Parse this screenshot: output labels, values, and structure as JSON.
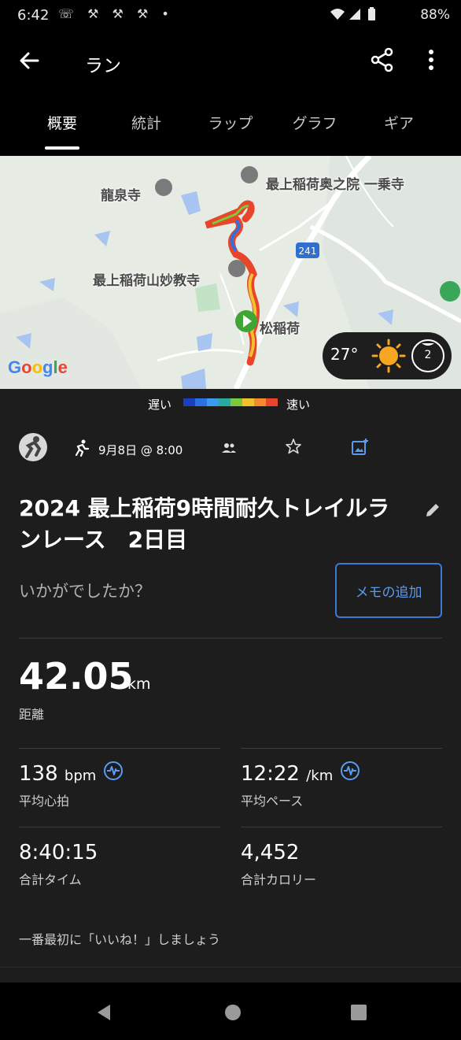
{
  "status_bar": {
    "time": "6:42",
    "notification_icons": "☏ ⚒ ⚒ ⚒ •",
    "battery": "88%"
  },
  "app_bar": {
    "title": "ラン"
  },
  "tabs": [
    {
      "label": "概要",
      "active": true
    },
    {
      "label": "統計",
      "active": false
    },
    {
      "label": "ラップ",
      "active": false
    },
    {
      "label": "グラフ",
      "active": false
    },
    {
      "label": "ギア",
      "active": false
    }
  ],
  "map": {
    "labels": {
      "ryusenji": "龍泉寺",
      "okunoin": "最上稲荷奥之院 一乗寺",
      "myokyoji": "最上稲荷山妙教寺",
      "matsuinari": "松稲荷",
      "route": "241"
    },
    "google": "Google",
    "weather": {
      "temperature": "27°",
      "moon_phase": "2"
    }
  },
  "legend": {
    "slow": "遅い",
    "fast": "速い",
    "colors": [
      "#1a3fbf",
      "#2b72e0",
      "#3a9af0",
      "#29a9a0",
      "#7cc93a",
      "#f2c12e",
      "#f28a2e",
      "#e8452a"
    ]
  },
  "activity": {
    "date": "9月8日 @ 8:00",
    "title": "2024 最上稲荷9時間耐久トレイルランレース　2日目",
    "prompt": "いかがでしたか？",
    "memo_button": "メモの追加",
    "distance": {
      "value": "42.05",
      "unit": "km",
      "label": "距離"
    },
    "avg_hr": {
      "value": "138",
      "unit": "bpm",
      "label": "平均心拍"
    },
    "avg_pace": {
      "value": "12:22",
      "unit": "/km",
      "label": "平均ペース"
    },
    "total_time": {
      "value": "8:40:15",
      "label": "合計タイム"
    },
    "calories": {
      "value": "4,452",
      "label": "合計カロリー"
    },
    "like_prompt": "一番最初に「いいね！」しましょう"
  },
  "colors": {
    "accent": "#3b7ad1",
    "background": "#1d1d1d"
  }
}
